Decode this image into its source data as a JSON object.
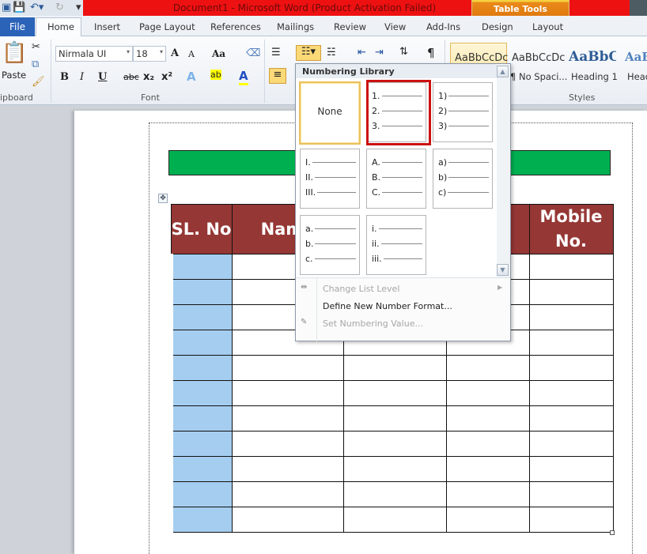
{
  "window": {
    "title": "Document1  -  Microsoft Word (Product Activation Failed)",
    "context_tab_group": "Table Tools"
  },
  "quick_access": {
    "icons": [
      "word-icon",
      "save-icon",
      "undo-icon",
      "redo-icon",
      "customize-icon"
    ]
  },
  "tabs": [
    {
      "label": "File"
    },
    {
      "label": "Home"
    },
    {
      "label": "Insert"
    },
    {
      "label": "Page Layout"
    },
    {
      "label": "References"
    },
    {
      "label": "Mailings"
    },
    {
      "label": "Review"
    },
    {
      "label": "View"
    },
    {
      "label": "Add-Ins"
    },
    {
      "label": "Design"
    },
    {
      "label": "Layout"
    }
  ],
  "ribbon": {
    "clipboard": {
      "paste_label": "Paste",
      "group_label": "ipboard"
    },
    "font": {
      "font_name": "Nirmala UI",
      "font_size": "18",
      "group_label": "Font",
      "bold": "B",
      "italic": "I",
      "underline": "U",
      "strike": "abc",
      "subscript": "x₂",
      "superscript": "x²",
      "grow": "A",
      "shrink": "A",
      "case": "Aa",
      "effects": "A",
      "highlight": "ab",
      "color": "A"
    },
    "paragraph": {
      "pilcrow": "¶"
    },
    "styles": {
      "group_label": "Styles",
      "items": [
        {
          "preview": "AaBbCcDc",
          "name": ""
        },
        {
          "preview": "AaBbCcDc",
          "name": "¶ No Spaci..."
        },
        {
          "preview": "AaBbCc",
          "name": "Heading 1"
        },
        {
          "preview": "AaB",
          "name": "Head"
        }
      ]
    }
  },
  "document": {
    "table_headers": [
      "SL. No",
      "Name",
      "",
      "",
      "Mobile No."
    ],
    "body_rows": 11,
    "colors": {
      "header": "#953735",
      "first_col": "#a5cdf0",
      "banner": "#00b050"
    }
  },
  "numbering_menu": {
    "title": "Numbering Library",
    "none_label": "None",
    "options": [
      [
        "1.",
        "2.",
        "3."
      ],
      [
        "1)",
        "2)",
        "3)"
      ],
      [
        "I.",
        "II.",
        "III."
      ],
      [
        "A.",
        "B.",
        "C."
      ],
      [
        "a)",
        "b)",
        "c)"
      ],
      [
        "a.",
        "b.",
        "c."
      ],
      [
        "i.",
        "ii.",
        "iii."
      ]
    ],
    "selected_highlight": "#cc1111",
    "items": [
      {
        "label": "Change List Level",
        "disabled": true
      },
      {
        "label": "Define New Number Format...",
        "disabled": false
      },
      {
        "label": "Set Numbering Value...",
        "disabled": true
      }
    ]
  }
}
